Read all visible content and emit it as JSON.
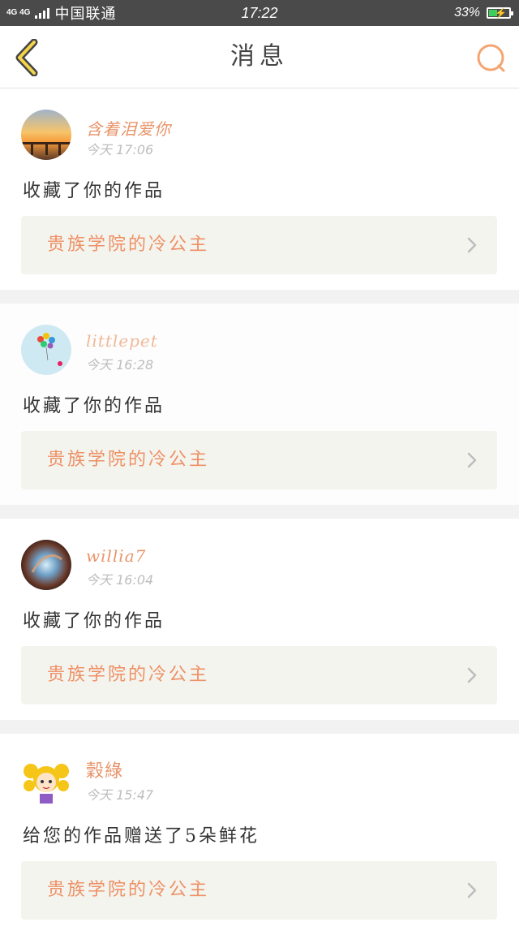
{
  "status_bar": {
    "network": "4G 4G",
    "carrier": "中国联通",
    "time": "17:22",
    "battery_percent": "33%"
  },
  "nav": {
    "title": "消息",
    "back_icon": "chevron-left-icon",
    "search_icon": "search-icon",
    "accent_color": "#f4a571"
  },
  "messages": [
    {
      "username": "含着泪爱你",
      "time": "今天 17:06",
      "text": "收藏了你的作品",
      "work_title": "贵族学院的冷公主"
    },
    {
      "username": "littlepet",
      "time": "今天 16:28",
      "text": "收藏了你的作品",
      "work_title": "贵族学院的冷公主"
    },
    {
      "username": "willia7",
      "time": "今天 16:04",
      "text": "收藏了你的作品",
      "work_title": "贵族学院的冷公主"
    },
    {
      "username": "穀綠",
      "time": "今天 15:47",
      "text": "给您的作品赠送了5朵鲜花",
      "work_title": "贵族学院的冷公主"
    }
  ]
}
